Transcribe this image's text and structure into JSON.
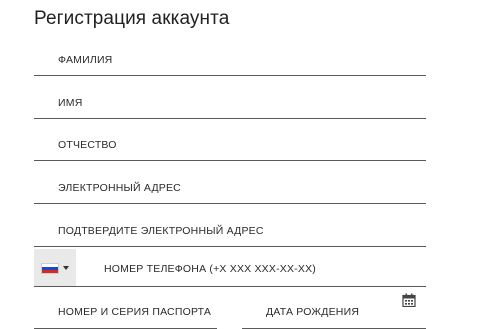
{
  "title": "Регистрация аккаунта",
  "fields": {
    "last_name": "ФАМИЛИЯ",
    "first_name": "ИМЯ",
    "patronymic": "ОТЧЕСТВО",
    "email": "ЭЛЕКТРОННЫЙ АДРЕС",
    "email_confirm": "ПОДТВЕРДИТЕ ЭЛЕКТРОННЫЙ АДРЕС",
    "phone": "НОМЕР ТЕЛЕФОНА  (+Х ХХХ ХХХ-ХХ-ХХ)",
    "passport": "НОМЕР И СЕРИЯ ПАСПОРТА",
    "birth_date": "ДАТА РОЖДЕНИЯ"
  },
  "icons": {
    "country_flag": "russia-flag-icon",
    "dropdown": "caret-down-icon",
    "calendar": "calendar-icon"
  },
  "colors": {
    "underline": "#5a5a5a",
    "country_select_bg": "#e9e9e9",
    "text": "#222222"
  }
}
